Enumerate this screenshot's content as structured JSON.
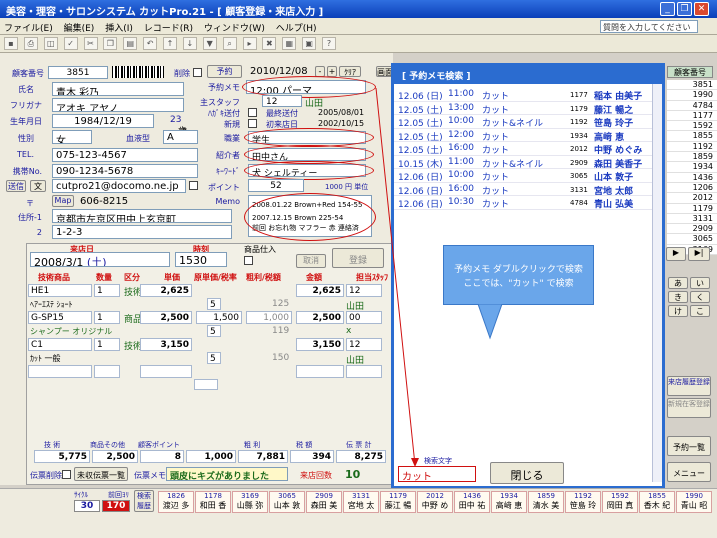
{
  "window": {
    "title": "美容・理容・サロンシステム カットPro.21 - [ 顧客登録・来店入力 ]"
  },
  "menu": [
    "ファイル(E)",
    "編集(E)",
    "挿入(I)",
    "レコード(R)",
    "ウィンドウ(W)",
    "ヘルプ(H)"
  ],
  "help_placeholder": "質問を入力してください",
  "customer": {
    "id_label": "顧客番号",
    "id": "3851",
    "delete_label": "削除",
    "reserve_btn": "予約",
    "reserve_date": "2010/12/08",
    "clear_btn": "ｸﾘｱ",
    "plus": "+",
    "minus": "-",
    "name_label": "氏名",
    "name": "青木 彩乃",
    "kana_label": "フリガナ",
    "kana": "アオキ アヤノ",
    "birth_label": "生年月日",
    "birth": "1984/12/19",
    "age": "23",
    "age_unit": "歳",
    "sex_label": "性別",
    "sex": "女",
    "blood_label": "血液型",
    "blood": "A",
    "tel_label": "TEL.",
    "tel": "075-123-4567",
    "mobile_label": "携帯No.",
    "mobile": "090-1234-5678",
    "mail_label": "送信",
    "mail_btn2": "文",
    "email": "cutpro21@docomo.ne.jp",
    "zip_label": "〒",
    "map_btn": "Map",
    "zip": "606-8215",
    "addr1_label": "住所-1",
    "addr1": "京都市左京区田中上玄京町",
    "addr2_label": "2",
    "addr2": "1-2-3",
    "memo_label": "予約メモ",
    "memo": "12:00 パーマ",
    "staff_label": "主スタッフ",
    "staff_no": "12",
    "staff": "山田",
    "dm_label": "ﾊｶﾞｷ送付",
    "last_visit_label": "最終送付",
    "last_visit": "2005/08/01",
    "new_label": "新規",
    "first_visit_label": "初来店日",
    "first_visit": "2002/10/15",
    "job_label": "職業",
    "job": "学生",
    "intro_label": "紹介者",
    "intro": "田中さん",
    "keyword_label": "ｷｰﾜｰﾄﾞ",
    "keyword": "犬 シェルティー",
    "point_label": "ポイント",
    "point": "52",
    "point_unit": "1000 円 単位",
    "memo2_label": "Memo",
    "memo2_line1": "2008.01.22 Brown+Red 154-55",
    "memo2_line2": "2007.12.15 Brown 225-54",
    "memo2_line3": "前回 お忘れ物 マフラー 赤 連絡済",
    "photo_tab": "画面"
  },
  "visit": {
    "date_label": "来店日",
    "date": "2008/3/1",
    "dow": "(土)",
    "time_label": "時刻",
    "time": "1530",
    "goods_label": "商品仕入",
    "cancel_btn": "取消",
    "register_btn": "登録",
    "headers": [
      "技術商品",
      "数量",
      "区分",
      "単価",
      "原単価/税率",
      "粗利/税額",
      "金額",
      "担当ｽﾀｯﾌ"
    ],
    "rows": [
      {
        "code": "HE1",
        "qty": "1",
        "kind": "技術",
        "price": "2,625",
        "cost": "",
        "profit": "",
        "amount": "2,625",
        "staff_no": "12",
        "name": "ﾍｱｰｴｽﾃ ｼｮｰﾄ",
        "tax": "5",
        "tax_amt": "125",
        "staff": "山田"
      },
      {
        "code": "G-SP15",
        "qty": "1",
        "kind": "商品",
        "price": "2,500",
        "cost": "1,500",
        "profit": "1,000",
        "amount": "2,500",
        "staff_no": "00",
        "name": "シャンプー オリジナル",
        "tax": "5",
        "tax_amt": "119",
        "staff": "x"
      },
      {
        "code": "C1",
        "qty": "1",
        "kind": "技術",
        "price": "3,150",
        "cost": "",
        "profit": "",
        "amount": "3,150",
        "staff_no": "12",
        "name": "ｶｯﾄ 一般",
        "tax": "5",
        "tax_amt": "150",
        "staff": "山田"
      }
    ],
    "totals_headers": [
      "技 術",
      "商品その他",
      "顧客ポイント",
      "粗 利",
      "税 額",
      "伝 票 計"
    ],
    "totals": [
      "5,775",
      "2,500",
      "8",
      "1,000",
      "7,881",
      "394",
      "8,275"
    ],
    "slip_delete": "伝票削除",
    "unpaid_btn": "未収伝票一覧",
    "slip_memo_label": "伝票メモ",
    "slip_memo": "頭皮にキズがありました",
    "visit_count_label": "来店回数",
    "visit_count": "10"
  },
  "popup": {
    "title": "[ 予約メモ検索 ]",
    "rows": [
      {
        "date": "12.06 (日)",
        "time": "11:00",
        "menu": "カット",
        "no": "1177",
        "name": "稲本 由美子"
      },
      {
        "date": "12.05 (土)",
        "time": "13:00",
        "menu": "カット",
        "no": "1179",
        "name": "藤江 暢之"
      },
      {
        "date": "12.05 (土)",
        "time": "10:00",
        "menu": "カット&ネイル",
        "no": "1192",
        "name": "笹島 玲子"
      },
      {
        "date": "12.05 (土)",
        "time": "12:00",
        "menu": "カット",
        "no": "1934",
        "name": "高﨑 恵"
      },
      {
        "date": "12.05 (土)",
        "time": "16:00",
        "menu": "カット",
        "no": "2012",
        "name": "中野 めぐみ"
      },
      {
        "date": "10.15 (木)",
        "time": "11:00",
        "menu": "カット&ネイル",
        "no": "2909",
        "name": "森田 美香子"
      },
      {
        "date": "12.06 (日)",
        "time": "10:00",
        "menu": "カット",
        "no": "3065",
        "name": "山本 敦子"
      },
      {
        "date": "12.06 (日)",
        "time": "16:00",
        "menu": "カット",
        "no": "3131",
        "name": "宮地 太郎"
      },
      {
        "date": "12.06 (日)",
        "time": "10:30",
        "menu": "カット",
        "no": "4784",
        "name": "青山 弘美"
      }
    ],
    "search_label": "検索文字",
    "search_value": "カット",
    "close_btn": "閉じる"
  },
  "callout": {
    "line1": "予約メモ ダブルクリックで検索",
    "line2": "ここでは、\"カット\" で検索"
  },
  "right_tab": "顧客番号",
  "right_numbers": [
    "3851",
    "1990",
    "4784",
    "1177",
    "1592",
    "1855",
    "1192",
    "1859",
    "1934",
    "1436",
    "1206",
    "2012",
    "1179",
    "3131",
    "2909",
    "3065",
    "3169"
  ],
  "right_kana": [
    "あ",
    "い",
    "き",
    "く",
    "け",
    "こ"
  ],
  "right_buttons": {
    "history": "来店履歴登録",
    "new_history": "新規在客登録",
    "reserve_list": "予約一覧",
    "menu": "メニュー"
  },
  "bottom": {
    "cycle_label": "ｻｲｸﾙ",
    "count_label": "前回ﾖﾘ",
    "cycle": "30",
    "count": "170",
    "history_btn": "検索履歴",
    "customers": [
      {
        "no": "1826",
        "name": "渡辺 多"
      },
      {
        "no": "1178",
        "name": "和田 香"
      },
      {
        "no": "3169",
        "name": "山縣 弥"
      },
      {
        "no": "3065",
        "name": "山本 敦"
      },
      {
        "no": "2909",
        "name": "森田 美"
      },
      {
        "no": "3131",
        "name": "宮地 太"
      },
      {
        "no": "1179",
        "name": "藤江 暢"
      },
      {
        "no": "2012",
        "name": "中野 め"
      },
      {
        "no": "1436",
        "name": "田中 祐"
      },
      {
        "no": "1934",
        "name": "高﨑 恵"
      },
      {
        "no": "1859",
        "name": "清水 美"
      },
      {
        "no": "1192",
        "name": "笹島 玲"
      },
      {
        "no": "1592",
        "name": "岡田 真"
      },
      {
        "no": "1855",
        "name": "香木 紀"
      },
      {
        "no": "1990",
        "name": "青山 昭"
      }
    ]
  }
}
